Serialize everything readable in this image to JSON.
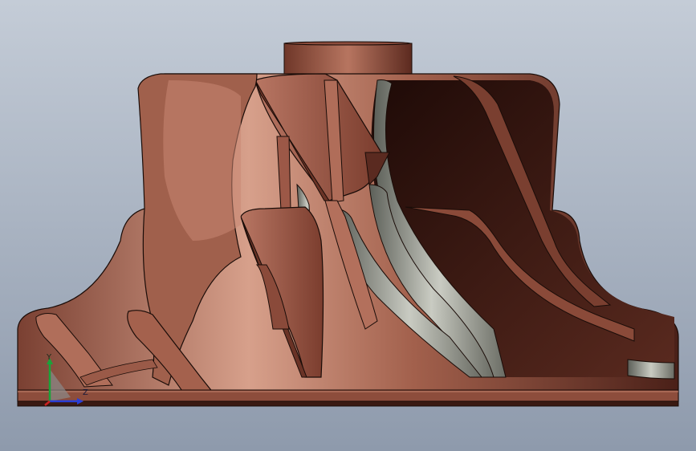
{
  "viewport": {
    "background_top": "#c3cbd6",
    "background_bottom": "#8f9bad"
  },
  "model": {
    "material_color": "#a0604c",
    "highlight_color": "#d69a86",
    "shadow_color": "#2f1410",
    "fillet_color": "#8f9088",
    "edge_color": "#1a0c08"
  },
  "triad": {
    "y_label": "Y",
    "z_label": "Z",
    "y_color": "#1aa33a",
    "z_color": "#2a3fd6",
    "x_color": "#cc2222"
  }
}
